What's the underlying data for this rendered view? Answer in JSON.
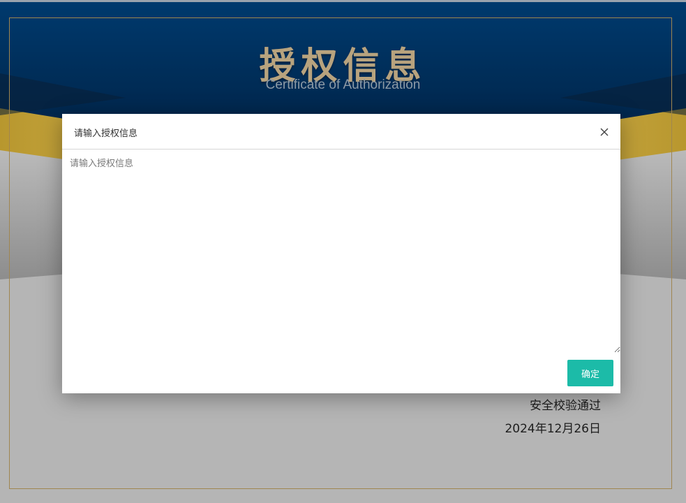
{
  "certificate": {
    "title": "授权信息",
    "subtitle": "Certificate of Authorization",
    "status": "安全校验通过",
    "date": "2024年12月26日"
  },
  "dialog": {
    "title": "请输入授权信息",
    "textarea_placeholder": "请输入授权信息",
    "textarea_value": "",
    "confirm_label": "确定",
    "close_icon": "close-icon"
  },
  "colors": {
    "header_navy": "#00325f",
    "gold_band": "#c9a84c",
    "confirm_teal": "#1cbba8",
    "title_gold": "#b8a37e"
  }
}
